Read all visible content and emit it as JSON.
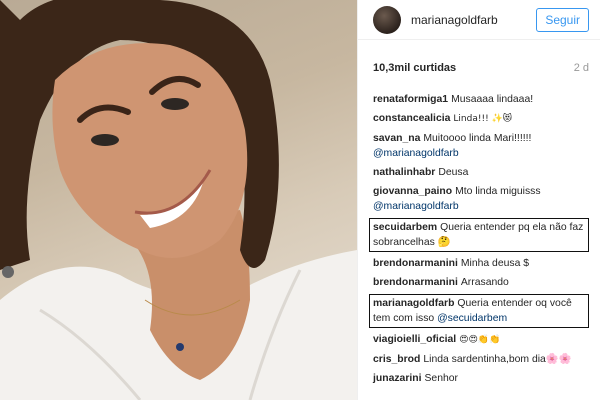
{
  "post": {
    "username": "marianagoldfarb",
    "follow_label": "Seguir",
    "likes_label": "10,3mil curtidas",
    "time_label": "2 d"
  },
  "comments": [
    {
      "user": "renataformiga1",
      "text": "Musaaaa lindaaa!",
      "mention": ""
    },
    {
      "user": "constancealicia",
      "text": "Linda!!! ✨😻",
      "mention": ""
    },
    {
      "user": "savan_na",
      "text": "Muitoooo linda Mari!!!!!!",
      "mention": "@marianagoldfarb"
    },
    {
      "user": "nathalinhabr",
      "text": "Deusa",
      "mention": ""
    },
    {
      "user": "giovanna_paino",
      "text": "Mto linda miguisss",
      "mention": "@marianagoldfarb"
    },
    {
      "user": "secuidarbem",
      "text": "Queria entender pq ela não faz sobrancelhas 🤔",
      "mention": ""
    },
    {
      "user": "brendonarmanini",
      "text": "Minha deusa $",
      "mention": ""
    },
    {
      "user": "brendonarmanini",
      "text": "Arrasando",
      "mention": ""
    },
    {
      "user": "marianagoldfarb",
      "text": "Queria entender oq você tem com isso",
      "mention": "@secuidarbem"
    },
    {
      "user": "viagioielli_oficial",
      "text": "😍😍👏👏",
      "mention": ""
    },
    {
      "user": "cris_brod",
      "text": "Linda sardentinha,bom dia🌸🌸",
      "mention": ""
    },
    {
      "user": "junazarini",
      "text": "Senhor",
      "mention": ""
    }
  ],
  "colors": {
    "accent": "#3897f0",
    "mention": "#003569",
    "highlight_box": "#111111"
  }
}
